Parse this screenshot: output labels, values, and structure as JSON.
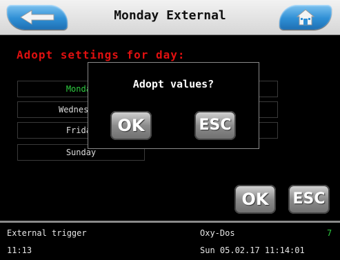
{
  "header": {
    "title": "Monday External",
    "back_icon": "back-arrow-icon",
    "home_icon": "home-icon"
  },
  "main": {
    "heading": "Adopt settings for day:",
    "days": [
      {
        "label": "Monday",
        "active": true
      },
      {
        "label": "Wednesday",
        "active": false
      },
      {
        "label": "Friday",
        "active": false
      },
      {
        "label": "Sunday",
        "active": false
      }
    ],
    "ok_label": "OK",
    "esc_label": "ESC"
  },
  "dialog": {
    "message": "Adopt values?",
    "ok_label": "OK",
    "esc_label": "ESC"
  },
  "footer": {
    "mode": "External trigger",
    "time": "11:13",
    "product": "Oxy-Dos",
    "status_number": "7",
    "datetime": "Sun 05.02.17 11:14:01"
  },
  "colors": {
    "accent_blue": "#2f8fd5",
    "heading_red": "#e01010",
    "active_green": "#2ecc40"
  }
}
